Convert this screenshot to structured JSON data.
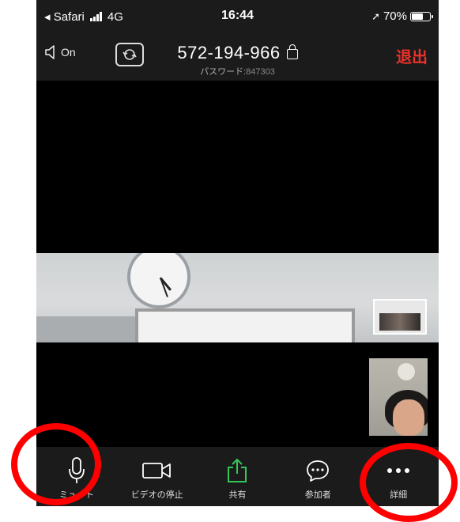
{
  "status_bar": {
    "back_app": "◂ Safari",
    "network": "4G",
    "time": "16:44",
    "battery_text": "70%",
    "battery_level": 0.7
  },
  "meeting": {
    "audio_label": "On",
    "meeting_id": "572-194-966",
    "password_label": "パスワード:",
    "password_value": "847303",
    "leave_label": "退出"
  },
  "toolbar": {
    "mute_label": "ミュート",
    "stop_video_label": "ビデオの停止",
    "share_label": "共有",
    "participants_label": "参加者",
    "more_label": "詳細"
  },
  "colors": {
    "leave": "#e8322b",
    "share": "#34c759",
    "annotation_ring": "#ff0000"
  }
}
